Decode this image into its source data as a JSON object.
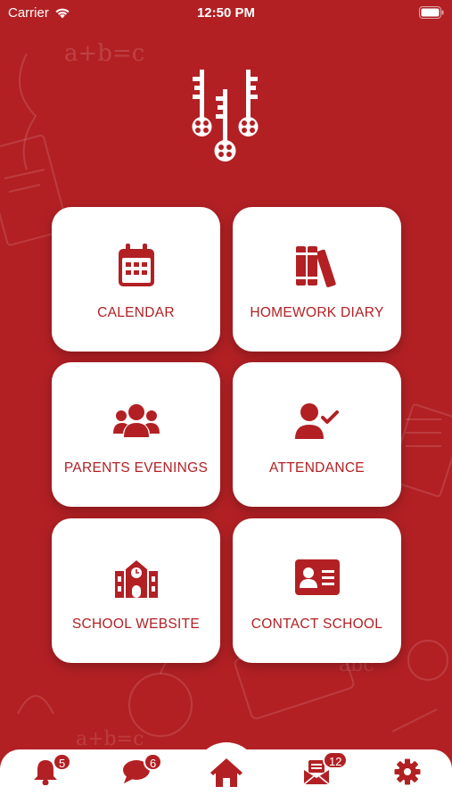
{
  "status": {
    "carrier": "Carrier",
    "time": "12:50 PM"
  },
  "colors": {
    "brand": "#b22024",
    "tile_bg": "#ffffff",
    "text": "#b22024"
  },
  "tiles": [
    {
      "label": "CALENDAR",
      "icon": "calendar-icon"
    },
    {
      "label": "HOMEWORK DIARY",
      "icon": "books-icon"
    },
    {
      "label": "PARENTS EVENINGS",
      "icon": "users-icon"
    },
    {
      "label": "ATTENDANCE",
      "icon": "user-check-icon"
    },
    {
      "label": "SCHOOL WEBSITE",
      "icon": "school-icon"
    },
    {
      "label": "CONTACT SCHOOL",
      "icon": "contact-card-icon"
    }
  ],
  "tabbar": {
    "notifications": {
      "icon": "bell-icon",
      "badge": "5"
    },
    "messages": {
      "icon": "chat-icon",
      "badge": "6"
    },
    "home": {
      "icon": "home-icon"
    },
    "mail": {
      "icon": "mail-icon",
      "badge": "12"
    },
    "settings": {
      "icon": "gear-icon"
    }
  }
}
